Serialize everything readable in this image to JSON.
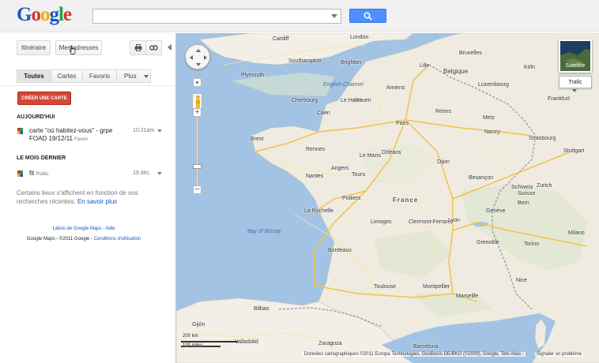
{
  "header": {
    "logo_letters": [
      "G",
      "o",
      "o",
      "g",
      "l",
      "e"
    ],
    "search_value": "",
    "search_placeholder": "",
    "icon_search": "search-icon"
  },
  "toolbar": {
    "itinerary_label": "Itinéraire",
    "my_addresses_label": "Mes adresses",
    "print_icon": "print-icon",
    "link_icon": "link-icon"
  },
  "tabs": [
    {
      "label": "Toutes",
      "active": true
    },
    {
      "label": "Cartes",
      "active": false
    },
    {
      "label": "Favoris",
      "active": false
    },
    {
      "label": "Plus",
      "active": false
    }
  ],
  "create_map_label": "CRÉER UNE CARTE",
  "sections": {
    "today": "AUJOURD'HUI",
    "last_month": "LE MOIS DERNIER"
  },
  "maps": [
    {
      "title": "carte \"où habitez-vous\" - grpe",
      "title_line2": "FOAD 19/12/11",
      "tag": "Favori",
      "time": "10:21am"
    },
    {
      "title": "fit",
      "tag": "Public",
      "time": "19 déc."
    }
  ],
  "recent_note": {
    "text": "Certains lieux s'affichent en fonction de vos recherches récentes.",
    "learn_more": "En savoir plus"
  },
  "footer": {
    "labs": "Labos de Google Maps - Aide",
    "prefix": "Google Maps - ©2011 Google -",
    "terms": "Conditions d'utilisation"
  },
  "map": {
    "satellite_label": "Satellite",
    "traffic_label": "Trafic",
    "scale_km": "200 km",
    "scale_miles": "100 miles",
    "copyright": "Données cartographiques ©2011 Europa Technologies, GeoBasis-DE/BKG (©2009), Google, Tele Atlas -",
    "report": "Signaler un problème",
    "country_label": "France",
    "sea_labels": [
      "English Channel",
      "Bay of Biscay"
    ],
    "cities": [
      "Cardiff",
      "London",
      "Southampton",
      "Brighton",
      "Plymouth",
      "Bruxelles",
      "Belgique",
      "Lille",
      "Amiens",
      "Rouen",
      "Caen",
      "Le Havre",
      "Cherbourg",
      "Brest",
      "Rennes",
      "Le Mans",
      "Paris",
      "Reims",
      "Metz",
      "Nancy",
      "Strasbourg",
      "Orléans",
      "Tours",
      "Angers",
      "Nantes",
      "Dijon",
      "Besançon",
      "Poitiers",
      "Limoges",
      "La Rochelle",
      "Clermont-Ferrand",
      "Lyon",
      "Genève",
      "Grenoble",
      "Bordeaux",
      "Toulouse",
      "Montpellier",
      "Marseille",
      "Nice",
      "Bilbao",
      "Zurich",
      "Bern",
      "Frankfurt",
      "Stuttgart",
      "Luxembourg",
      "Köln",
      "Valladolid",
      "Zaragoza",
      "Barcelona",
      "Torino",
      "Milano",
      "Gijón",
      "Luxembourg",
      "Schweiz",
      "Suisse"
    ]
  }
}
